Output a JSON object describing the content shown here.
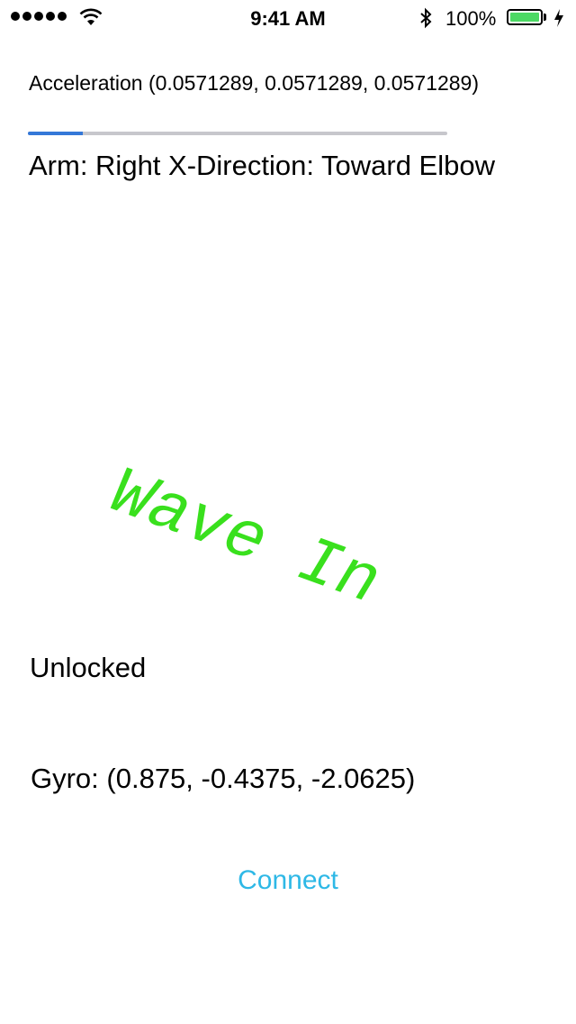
{
  "status_bar": {
    "time": "9:41 AM",
    "battery_percent": "100%",
    "signal_bars": 5,
    "battery_level": 1.0,
    "icons": [
      "signal-icon",
      "wifi-icon",
      "bluetooth-icon",
      "battery-icon",
      "charging-icon"
    ]
  },
  "main": {
    "acceleration": "Acceleration (0.0571289, 0.0571289, 0.0571289)",
    "progress": 0.13,
    "arm": "Arm: Right X-Direction: Toward Elbow",
    "gesture": "Wave In",
    "lock_state": "Unlocked",
    "gyro": "Gyro: (0.875, -0.4375, -2.0625)",
    "connect_label": "Connect"
  },
  "colors": {
    "gesture": "#39e01d",
    "connect": "#2eb8e6",
    "progress_fill": "#3478d8",
    "progress_track": "#c7c7cc",
    "battery_fill": "#4cd964"
  }
}
